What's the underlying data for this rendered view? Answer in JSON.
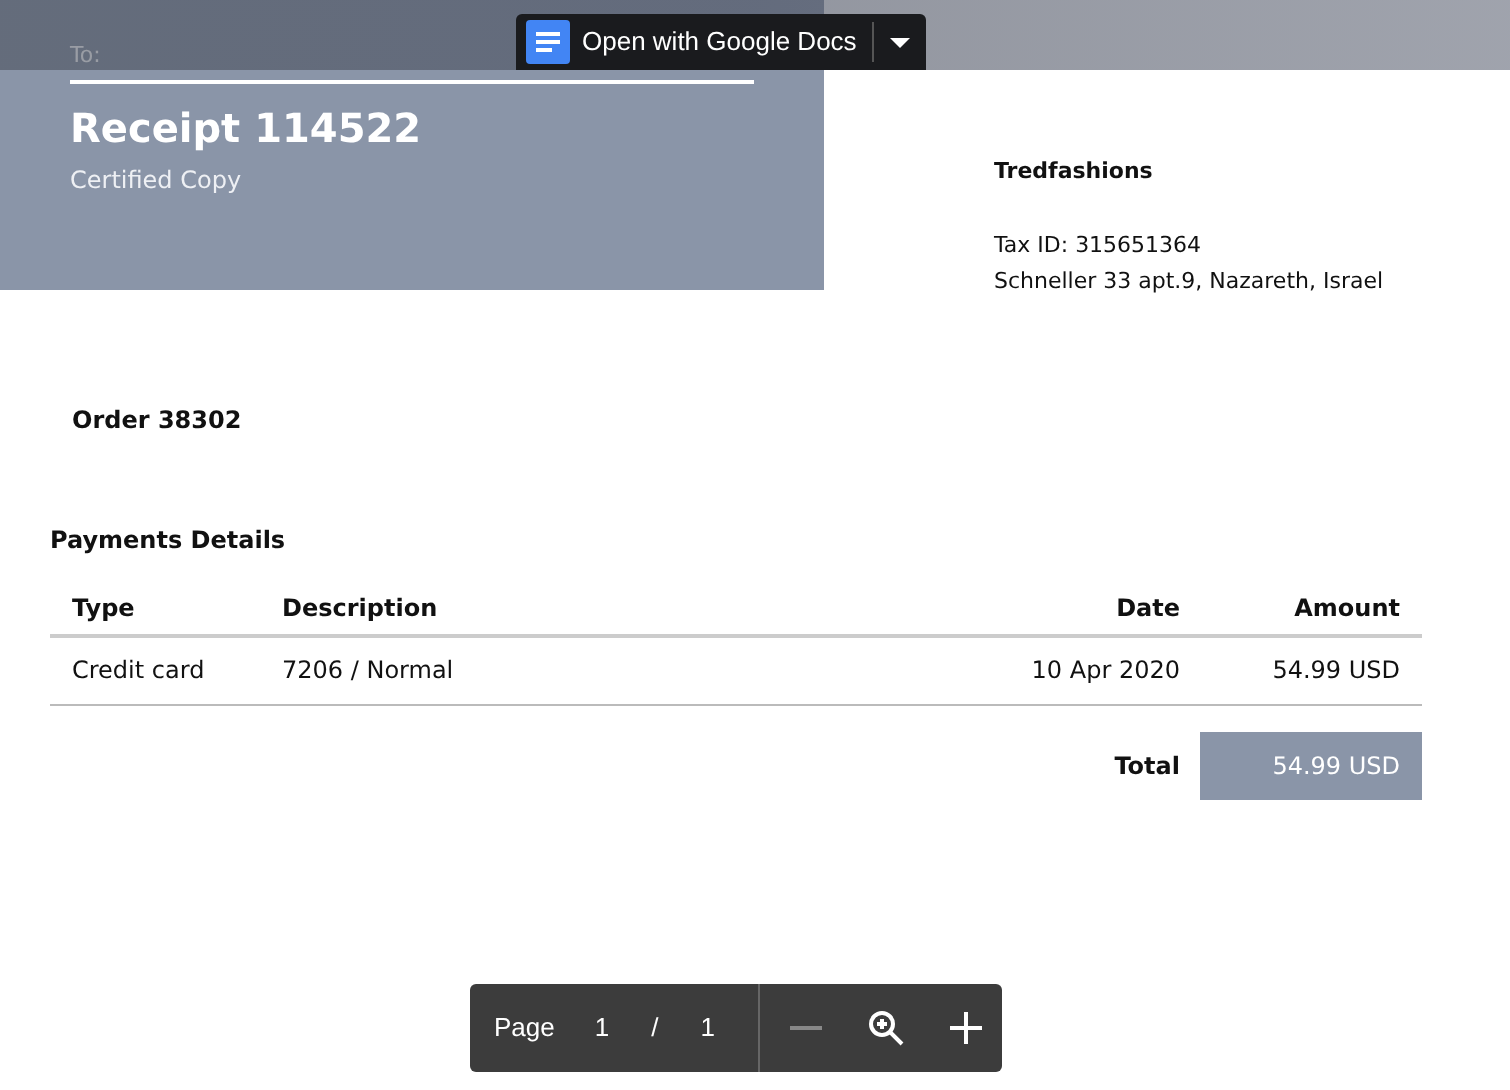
{
  "viewer": {
    "open_with": "Open with Google Docs"
  },
  "header": {
    "to_label": "To:",
    "title": "Receipt 114522",
    "subtitle": "Certified Copy"
  },
  "seller": {
    "name": "Tredfashions",
    "tax_id": "Tax ID: 315651364",
    "address": "Schneller 33 apt.9, Nazareth, Israel"
  },
  "order": "Order 38302",
  "payments": {
    "title": "Payments Details",
    "columns": [
      "Type",
      "Description",
      "Date",
      "Amount"
    ],
    "rows": [
      [
        "Credit card",
        "7206 / Normal",
        "10 Apr 2020",
        "54.99 USD"
      ]
    ],
    "total_label": "Total",
    "total_value": "54.99 USD"
  },
  "page_toolbar": {
    "label": "Page",
    "current": "1",
    "separator": "/",
    "total": "1"
  }
}
